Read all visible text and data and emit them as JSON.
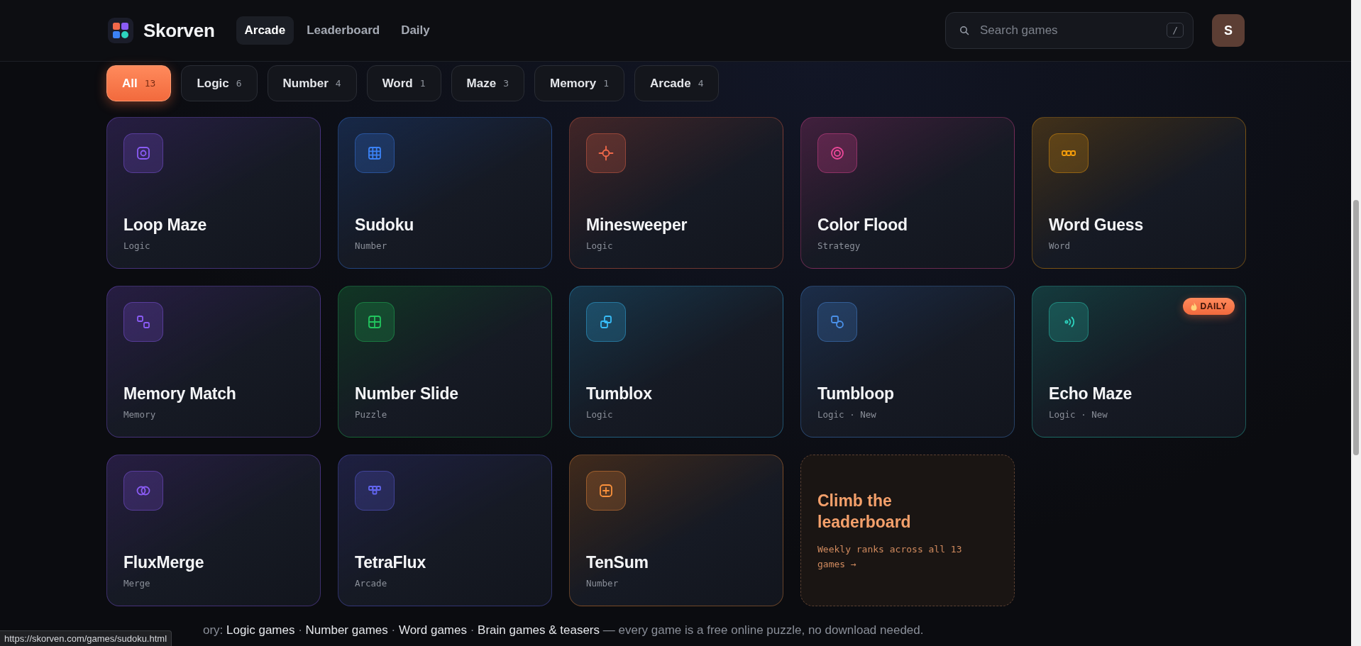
{
  "header": {
    "brand": "Skorven",
    "nav": [
      {
        "label": "Arcade",
        "selected": true
      },
      {
        "label": "Leaderboard",
        "selected": false
      },
      {
        "label": "Daily",
        "selected": false
      }
    ],
    "search": {
      "placeholder": "Search games",
      "shortcut": "/"
    },
    "avatar": "S"
  },
  "filters": [
    {
      "label": "All",
      "count": "13",
      "selected": true
    },
    {
      "label": "Logic",
      "count": "6",
      "selected": false
    },
    {
      "label": "Number",
      "count": "4",
      "selected": false
    },
    {
      "label": "Word",
      "count": "1",
      "selected": false
    },
    {
      "label": "Maze",
      "count": "3",
      "selected": false
    },
    {
      "label": "Memory",
      "count": "1",
      "selected": false
    },
    {
      "label": "Arcade",
      "count": "4",
      "selected": false
    }
  ],
  "games": [
    {
      "kind": "game",
      "title": "Loop Maze",
      "subtitle": "Logic",
      "color": "#8b5cf6"
    },
    {
      "kind": "game",
      "title": "Sudoku",
      "subtitle": "Number",
      "color": "#3b82f6"
    },
    {
      "kind": "game",
      "title": "Minesweeper",
      "subtitle": "Logic",
      "color": "#f2694a"
    },
    {
      "kind": "game",
      "title": "Color Flood",
      "subtitle": "Strategy",
      "color": "#ec4899"
    },
    {
      "kind": "game",
      "title": "Word Guess",
      "subtitle": "Word",
      "color": "#f59e0b"
    },
    {
      "kind": "game",
      "title": "Memory Match",
      "subtitle": "Memory",
      "color": "#8b5cf6"
    },
    {
      "kind": "game",
      "title": "Number Slide",
      "subtitle": "Puzzle",
      "color": "#22c55e"
    },
    {
      "kind": "game",
      "title": "Tumblox",
      "subtitle": "Logic",
      "color": "#38bdf8"
    },
    {
      "kind": "game",
      "title": "Tumbloop",
      "subtitle": "Logic · New",
      "color": "#4a90e8"
    },
    {
      "kind": "game",
      "title": "Echo Maze",
      "subtitle": "Logic · New",
      "color": "#2dd4bf",
      "badge": "DAILY"
    },
    {
      "kind": "game",
      "title": "FluxMerge",
      "subtitle": "Merge",
      "color": "#8b5cf6"
    },
    {
      "kind": "game",
      "title": "TetraFlux",
      "subtitle": "Arcade",
      "color": "#6366f1"
    },
    {
      "kind": "game",
      "title": "TenSum",
      "subtitle": "Number",
      "color": "#fb923c"
    },
    {
      "kind": "promo",
      "title": "Climb the leaderboard",
      "subtitle": "Weekly ranks across all 13 games →"
    }
  ],
  "footer": {
    "lead": "ory:",
    "links": [
      "Logic games",
      "Number games",
      "Word games",
      "Brain games & teasers"
    ],
    "separator": "·",
    "tail": "— every game is a free online puzzle, no download needed."
  },
  "status_url": "https://skorven.com/games/sudoku.html"
}
